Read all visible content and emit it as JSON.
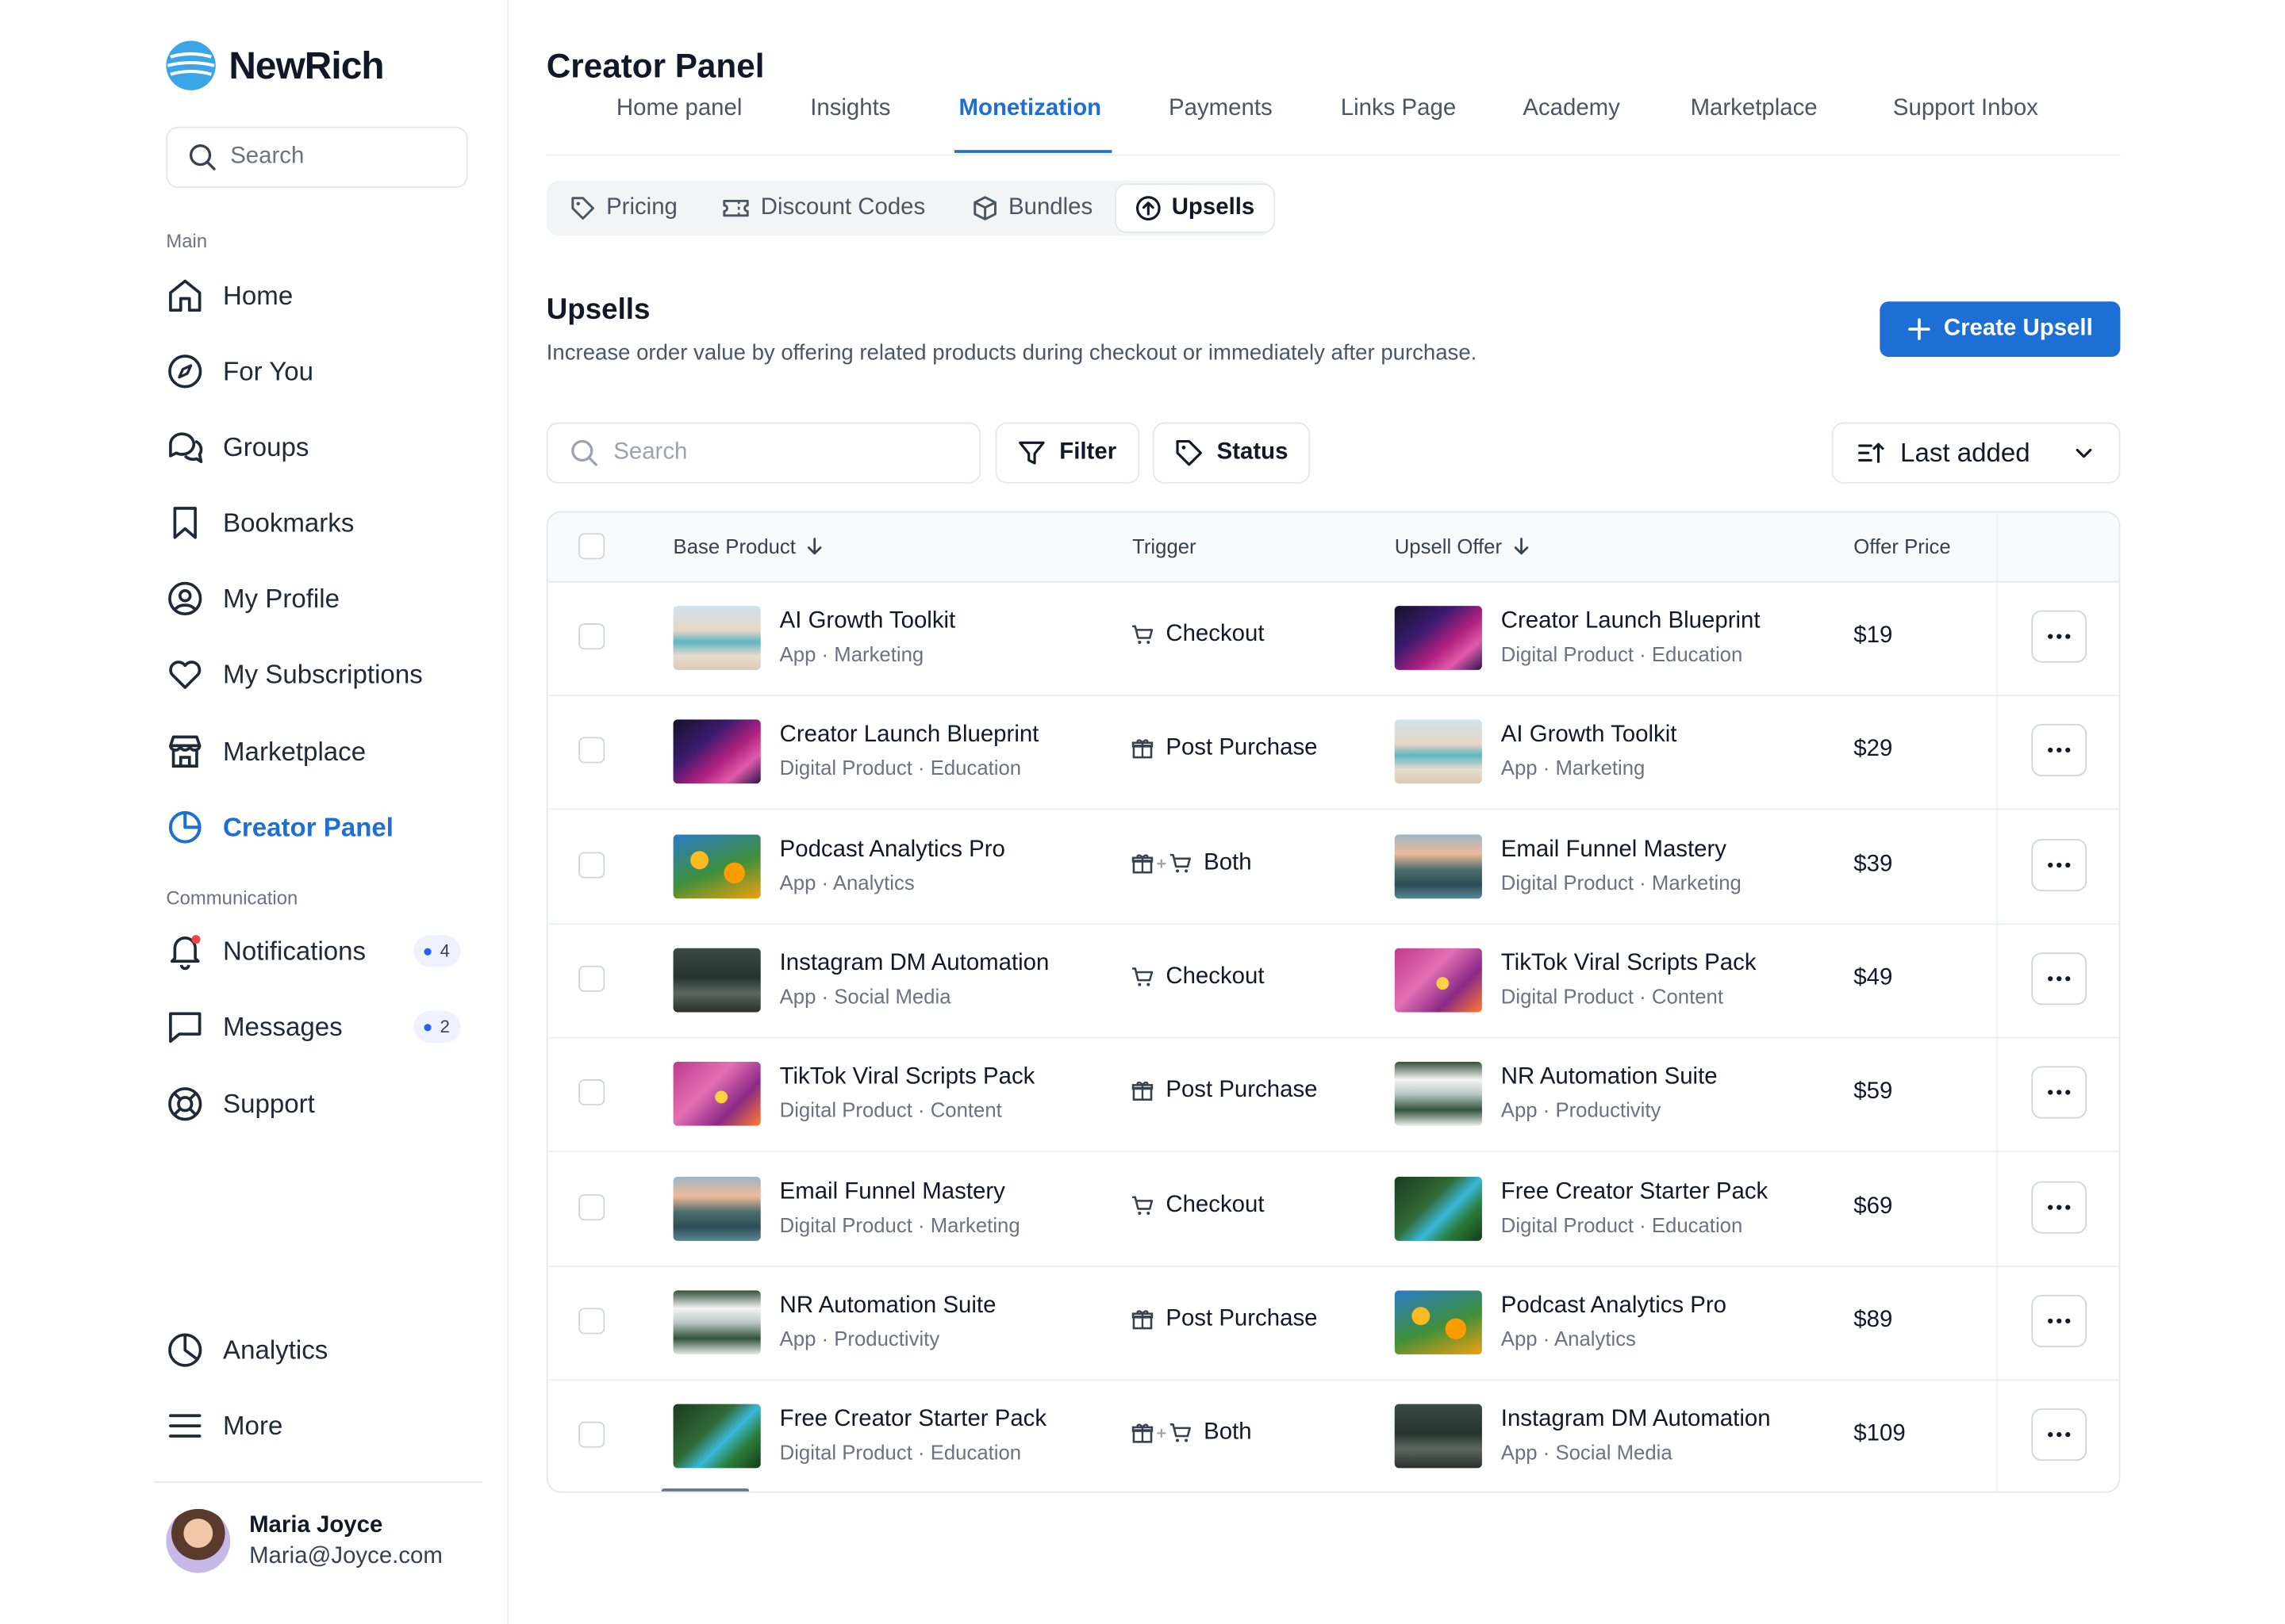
{
  "app": {
    "name": "NewRich"
  },
  "sidebar": {
    "search_placeholder": "Search",
    "section_main": "Main",
    "section_communication": "Communication",
    "items": [
      {
        "label": "Home",
        "icon": "home-icon"
      },
      {
        "label": "For You",
        "icon": "compass-icon"
      },
      {
        "label": "Groups",
        "icon": "chat-bubbles-icon"
      },
      {
        "label": "Bookmarks",
        "icon": "bookmark-icon"
      },
      {
        "label": "My Profile",
        "icon": "user-circle-icon"
      },
      {
        "label": "My Subscriptions",
        "icon": "heart-icon"
      },
      {
        "label": "Marketplace",
        "icon": "storefront-icon"
      },
      {
        "label": "Creator Panel",
        "icon": "pie-chart-icon",
        "active": true
      }
    ],
    "comm_items": [
      {
        "label": "Notifications",
        "icon": "bell-icon",
        "badge": "4"
      },
      {
        "label": "Messages",
        "icon": "message-icon",
        "badge": "2"
      },
      {
        "label": "Support",
        "icon": "lifebuoy-icon"
      }
    ],
    "bottom_items": [
      {
        "label": "Analytics",
        "icon": "analytics-icon"
      },
      {
        "label": "More",
        "icon": "menu-icon"
      }
    ],
    "user": {
      "name": "Maria Joyce",
      "email": "Maria@Joyce.com"
    }
  },
  "header": {
    "title": "Creator Panel",
    "tabs": [
      "Home panel",
      "Insights",
      "Monetization",
      "Payments",
      "Links Page",
      "Academy",
      "Marketplace",
      "Support Inbox"
    ],
    "active_tab": "Monetization"
  },
  "subtabs": [
    {
      "label": "Pricing",
      "icon": "tag-icon"
    },
    {
      "label": "Discount Codes",
      "icon": "ticket-icon"
    },
    {
      "label": "Bundles",
      "icon": "box-icon"
    },
    {
      "label": "Upsells",
      "icon": "arrow-up-circle-icon",
      "active": true
    }
  ],
  "section": {
    "title": "Upsells",
    "description": "Increase order value by offering related products during checkout or immediately after purchase.",
    "create_button": "Create Upsell"
  },
  "toolbar": {
    "search_placeholder": "Search",
    "filter_label": "Filter",
    "status_label": "Status",
    "sort_label": "Last added"
  },
  "table": {
    "columns": {
      "base_product": "Base Product",
      "trigger": "Trigger",
      "upsell_offer": "Upsell Offer",
      "offer_price": "Offer Price"
    },
    "rows": [
      {
        "base": "AI Growth Toolkit",
        "base_type": "App",
        "base_cat": "Marketing",
        "trigger": "Checkout",
        "offer": "Creator Launch Blueprint",
        "offer_type": "Digital Product",
        "offer_cat": "Education",
        "price": "$19"
      },
      {
        "base": "Creator Launch Blueprint",
        "base_type": "Digital Product",
        "base_cat": "Education",
        "trigger": "Post Purchase",
        "offer": "AI Growth Toolkit",
        "offer_type": "App",
        "offer_cat": "Marketing",
        "price": "$29"
      },
      {
        "base": "Podcast Analytics Pro",
        "base_type": "App",
        "base_cat": "Analytics",
        "trigger": "Both",
        "offer": "Email Funnel Mastery",
        "offer_type": "Digital Product",
        "offer_cat": "Marketing",
        "price": "$39"
      },
      {
        "base": "Instagram DM Automation",
        "base_type": "App",
        "base_cat": "Social Media",
        "trigger": "Checkout",
        "offer": "TikTok Viral Scripts Pack",
        "offer_type": "Digital Product",
        "offer_cat": "Content",
        "price": "$49"
      },
      {
        "base": "TikTok Viral Scripts Pack",
        "base_type": "Digital Product",
        "base_cat": "Content",
        "trigger": "Post Purchase",
        "offer": "NR Automation Suite",
        "offer_type": "App",
        "offer_cat": "Productivity",
        "price": "$59"
      },
      {
        "base": "Email Funnel Mastery",
        "base_type": "Digital Product",
        "base_cat": "Marketing",
        "trigger": "Checkout",
        "offer": "Free Creator Starter Pack",
        "offer_type": "Digital Product",
        "offer_cat": "Education",
        "price": "$69"
      },
      {
        "base": "NR Automation Suite",
        "base_type": "App",
        "base_cat": "Productivity",
        "trigger": "Post Purchase",
        "offer": "Podcast Analytics Pro",
        "offer_type": "App",
        "offer_cat": "Analytics",
        "price": "$89"
      },
      {
        "base": "Free Creator Starter Pack",
        "base_type": "Digital Product",
        "base_cat": "Education",
        "trigger": "Both",
        "offer": "Instagram DM Automation",
        "offer_type": "App",
        "offer_cat": "Social Media",
        "price": "$109"
      }
    ]
  },
  "colors": {
    "accent": "#1d6fd6",
    "text": "#111827",
    "muted": "#6b7280",
    "border": "#e5e7eb"
  }
}
